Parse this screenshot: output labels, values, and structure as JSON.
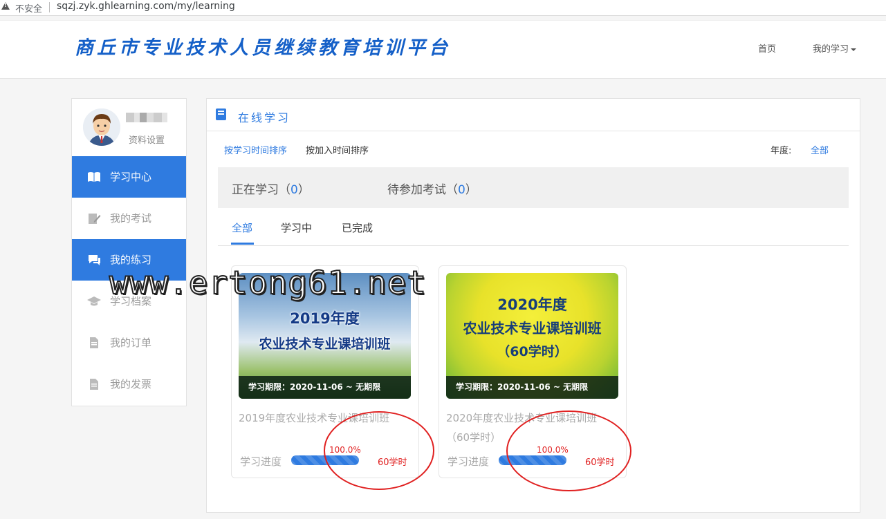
{
  "browser": {
    "insecure_label": "不安全",
    "url": "sqzj.zyk.ghlearning.com/my/learning"
  },
  "header": {
    "logo_text": "商丘市专业技术人员继续教育培训平台",
    "nav_home": "首页",
    "nav_my_learning": "我的学习"
  },
  "sidebar": {
    "profile_settings": "资料设置",
    "items": [
      {
        "label": "学习中心",
        "icon": "book-icon",
        "active": true
      },
      {
        "label": "我的考试",
        "icon": "edit-icon",
        "active": false
      },
      {
        "label": "我的练习",
        "icon": "chat-icon",
        "active": true
      },
      {
        "label": "学习档案",
        "icon": "graduation-cap-icon",
        "active": false
      },
      {
        "label": "我的订单",
        "icon": "document-icon",
        "active": false
      },
      {
        "label": "我的发票",
        "icon": "invoice-icon",
        "active": false
      }
    ]
  },
  "main": {
    "title": "在线学习",
    "sort_by_study_time": "按学习时间排序",
    "sort_by_join_time": "按加入时间排序",
    "year_label": "年度:",
    "year_value": "全部",
    "stats": {
      "studying_label": "正在学习",
      "studying_count": "0",
      "exam_label": "待参加考试",
      "exam_count": "0"
    },
    "tabs": [
      "全部",
      "学习中",
      "已完成"
    ],
    "courses": [
      {
        "image_line1": "2019年度",
        "image_line2": "农业技术专业课培训班",
        "period": "学习期限：2020-11-06 ~ 无期限",
        "title": "2019年度农业技术专业课培训班",
        "progress_label": "学习进度",
        "progress_pct": "100.0%",
        "progress": 1.0,
        "hours": "60学时"
      },
      {
        "image_line1": "2020年度",
        "image_line2": "农业技术专业课培训班",
        "image_line3": "（60学时）",
        "period": "学习期限：2020-11-06 ~ 无期限",
        "title": "2020年度农业技术专业课培训班（60学时）",
        "progress_label": "学习进度",
        "progress_pct": "100.0%",
        "progress": 1.0,
        "hours": "60学时"
      }
    ]
  },
  "watermark": "www.ertong61.net",
  "colors": {
    "accent": "#2f7be0",
    "highlight": "#e02020"
  }
}
